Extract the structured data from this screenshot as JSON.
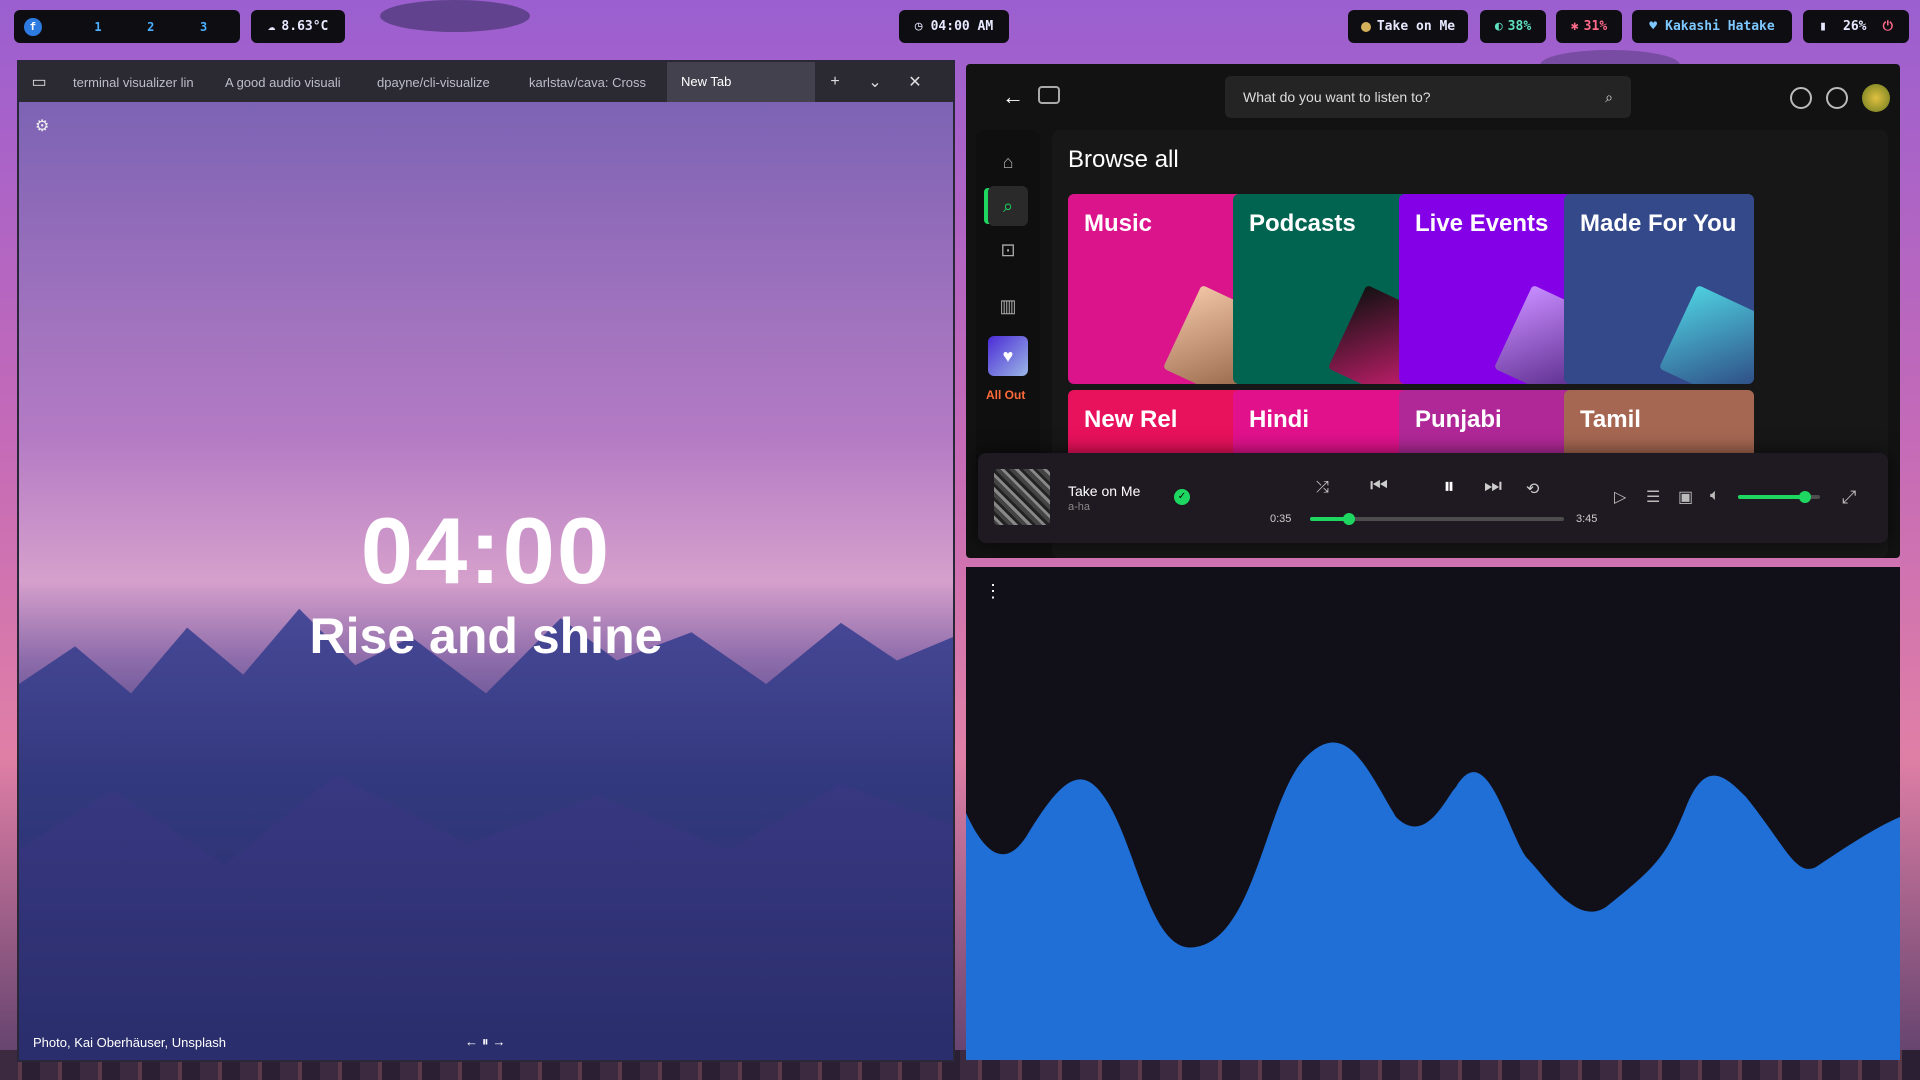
{
  "topbar": {
    "workspaces": [
      "1",
      "2",
      "3"
    ],
    "weather": "8.63°C",
    "clock": "04:00 AM",
    "now_playing": "Take on Me",
    "cpu": "38%",
    "memory": "31%",
    "user": "Kakashi Hatake",
    "battery": "26%"
  },
  "browser": {
    "tabs": [
      {
        "label": "terminal visualizer lin"
      },
      {
        "label": "A good audio visuali"
      },
      {
        "label": "dpayne/cli-visualize"
      },
      {
        "label": "karlstav/cava: Cross"
      },
      {
        "label": "New Tab"
      }
    ],
    "active_tab": "New Tab",
    "clock": "04:00",
    "greeting": "Rise and shine",
    "photo_credit": "Photo, Kai Oberhäuser, Unsplash"
  },
  "spotify": {
    "search_placeholder": "What do you want to listen to?",
    "section_title": "Browse all",
    "cards": [
      {
        "label": "Music",
        "color": "#dc148c"
      },
      {
        "label": "Podcasts",
        "color": "#006450"
      },
      {
        "label": "Live Events",
        "color": "#8400e7"
      },
      {
        "label": "Made For You",
        "color": "#1e3264"
      }
    ],
    "cards_row2": [
      {
        "label": "New Rel",
        "color": "#e8115b"
      },
      {
        "label": "Hindi",
        "color": "#e1118c"
      },
      {
        "label": "Punjabi",
        "color": "#b02897"
      },
      {
        "label": "Tamil",
        "color": "#a56752"
      }
    ],
    "sidebar_partial_label": "All Out",
    "player": {
      "track": "Take on Me",
      "artist": "a-ha",
      "elapsed": "0:35",
      "duration": "3:45",
      "progress": 0.155,
      "volume": 0.82
    }
  },
  "colors": {
    "spotify_green": "#1ed760",
    "cava_fill": "#1f6fd6",
    "bar_bg": "#0d0d12"
  }
}
